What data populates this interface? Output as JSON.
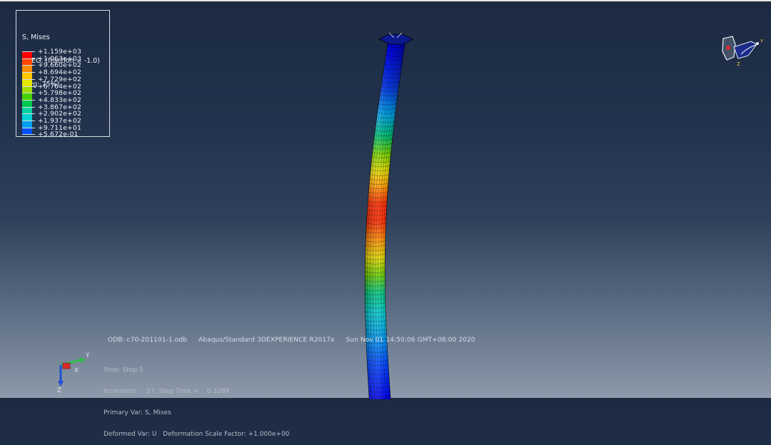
{
  "legend": {
    "title": "S, Mises",
    "subtitle": "SNEG, (fraction = -1.0)",
    "averaging": "(Avg: 75%)",
    "levels": [
      {
        "value": "+1.159e+03",
        "color": "#ff0000"
      },
      {
        "value": "+1.063e+03",
        "color": "#ff4600"
      },
      {
        "value": "+9.660e+02",
        "color": "#ff8c00"
      },
      {
        "value": "+8.694e+02",
        "color": "#ffc800"
      },
      {
        "value": "+7.729e+02",
        "color": "#e6e600"
      },
      {
        "value": "+6.764e+02",
        "color": "#a0dc00"
      },
      {
        "value": "+5.798e+02",
        "color": "#46d200"
      },
      {
        "value": "+4.833e+02",
        "color": "#00c850"
      },
      {
        "value": "+3.867e+02",
        "color": "#00d2a0"
      },
      {
        "value": "+2.902e+02",
        "color": "#00d2d2"
      },
      {
        "value": "+1.937e+02",
        "color": "#00a0f0"
      },
      {
        "value": "+9.711e+01",
        "color": "#0050ff"
      },
      {
        "value": "+5.672e-01",
        "color": "#0000ff"
      }
    ]
  },
  "odb": {
    "file": "ODB: c70-201101-1.odb",
    "solver": "Abaqus/Standard 3DEXPERIENCE R2017x",
    "timestamp": "Sun Nov 01 14:50:06 GMT+08:00 2020"
  },
  "status": {
    "step": "Step: Step-1",
    "increment": "Increment     17: Step Time =    0.3289",
    "primary_var": "Primary Var: S, Mises",
    "deformed_var": "Deformed Var: U   Deformation Scale Factor: +1.000e+00"
  },
  "triad": {
    "y": "Y",
    "x": "X",
    "z": "Z",
    "y_color": "#2fbf4a",
    "x_color": "#d92a2a",
    "z_color": "#1f4fd6"
  },
  "view_cube": {
    "y": "Y",
    "z": "Z"
  }
}
